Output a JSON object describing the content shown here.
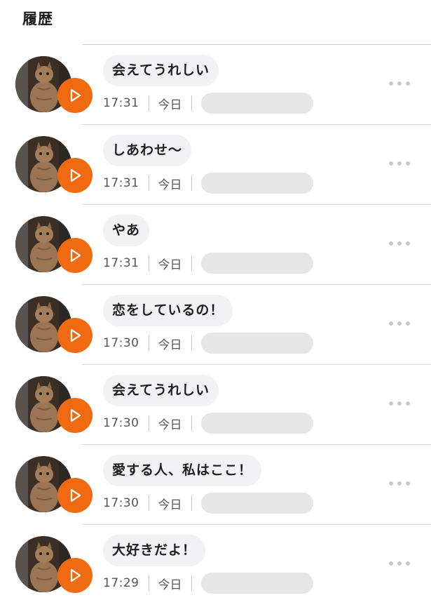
{
  "header": {
    "title": "履歴"
  },
  "items": [
    {
      "message": "会えてうれしい",
      "time": "17:31",
      "day": "今日"
    },
    {
      "message": "しあわせ〜",
      "time": "17:31",
      "day": "今日"
    },
    {
      "message": "やあ",
      "time": "17:31",
      "day": "今日"
    },
    {
      "message": "恋をしているの！",
      "time": "17:30",
      "day": "今日"
    },
    {
      "message": "会えてうれしい",
      "time": "17:30",
      "day": "今日"
    },
    {
      "message": "愛する人、私はここ！",
      "time": "17:30",
      "day": "今日"
    },
    {
      "message": "大好きだよ！",
      "time": "17:29",
      "day": "今日"
    }
  ],
  "icons": {
    "play": "play-icon",
    "more": "more-dots-icon",
    "avatar": "cat-photo-avatar"
  },
  "colors": {
    "accent": "#ef6a11",
    "bubble": "#f2f2f4",
    "divider": "#d9d9d9",
    "redaction": "#e6e6e6"
  }
}
